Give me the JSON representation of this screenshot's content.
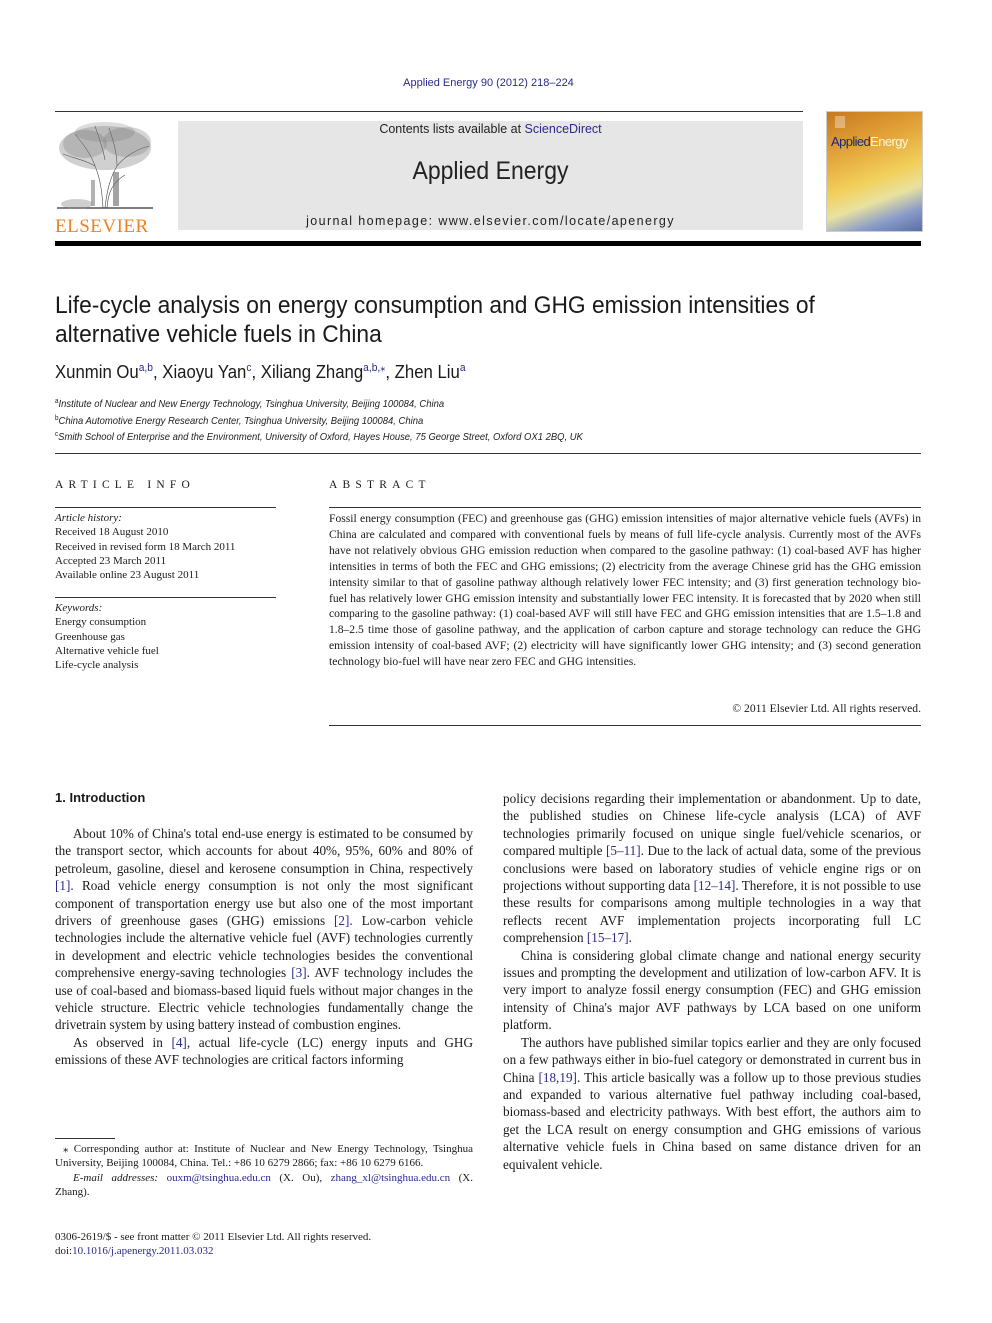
{
  "header": {
    "journal_reference": "Applied Energy 90 (2012) 218–224",
    "contents_prefix": "Contents lists available at ",
    "contents_link": "ScienceDirect",
    "journal_name": "Applied Energy",
    "homepage_label": "journal homepage: www.elsevier.com/locate/apenergy",
    "publisher_logo_text": "ELSEVIER",
    "cover_title_part1": "Applied",
    "cover_title_part2": "Energy",
    "colors": {
      "elsevier_orange": "#f08020",
      "link_blue": "#2a2a8a",
      "header_band_gray": "#e6e6e6"
    }
  },
  "article": {
    "title": "Life-cycle analysis on energy consumption and GHG emission intensities of alternative vehicle fuels in China",
    "authors": [
      {
        "name": "Xunmin Ou",
        "affil": "a,b",
        "sep": ", "
      },
      {
        "name": "Xiaoyu Yan",
        "affil": "c",
        "sep": ", "
      },
      {
        "name": "Xiliang Zhang",
        "affil": "a,b,⁎",
        "sep": ", "
      },
      {
        "name": "Zhen Liu",
        "affil": "a",
        "sep": ""
      }
    ],
    "affiliations": [
      {
        "mark": "a",
        "text": "Institute of Nuclear and New Energy Technology, Tsinghua University, Beijing 100084, China"
      },
      {
        "mark": "b",
        "text": "China Automotive Energy Research Center, Tsinghua University, Beijing 100084, China"
      },
      {
        "mark": "c",
        "text": "Smith School of Enterprise and the Environment, University of Oxford, Hayes House, 75 George Street, Oxford OX1 2BQ, UK"
      }
    ]
  },
  "article_info": {
    "heading": "ARTICLE INFO",
    "history_label": "Article history:",
    "history": [
      "Received 18 August 2010",
      "Received in revised form 18 March 2011",
      "Accepted 23 March 2011",
      "Available online 23 August 2011"
    ],
    "keywords_label": "Keywords:",
    "keywords": [
      "Energy consumption",
      "Greenhouse gas",
      "Alternative vehicle fuel",
      "Life-cycle analysis"
    ]
  },
  "abstract": {
    "heading": "ABSTRACT",
    "text": "Fossil energy consumption (FEC) and greenhouse gas (GHG) emission intensities of major alternative vehicle fuels (AVFs) in China are calculated and compared with conventional fuels by means of full life-cycle analysis. Currently most of the AVFs have not relatively obvious GHG emission reduction when compared to the gasoline pathway: (1) coal-based AVF has higher intensities in terms of both the FEC and GHG emissions; (2) electricity from the average Chinese grid has the GHG emission intensity similar to that of gasoline pathway although relatively lower FEC intensity; and (3) first generation technology bio-fuel has relatively lower GHG emission intensity and substantially lower FEC intensity. It is forecasted that by 2020 when still comparing to the gasoline pathway: (1) coal-based AVF will still have FEC and GHG emission intensities that are 1.5–1.8 and 1.8–2.5 time those of gasoline pathway, and the application of carbon capture and storage technology can reduce the GHG emission intensity of coal-based AVF; (2) electricity will have significantly lower GHG intensity; and (3) second generation technology bio-fuel will have near zero FEC and GHG intensities.",
    "copyright": "© 2011 Elsevier Ltd. All rights reserved."
  },
  "introduction": {
    "heading": "1. Introduction",
    "left_paragraphs": [
      {
        "parts": [
          {
            "t": "About 10% of China's total end-use energy is estimated to be consumed by the transport sector, which accounts for about 40%, 95%, 60% and 80% of petroleum, gasoline, diesel and kerosene consumption in China, respectively "
          },
          {
            "ref": "[1]"
          },
          {
            "t": ". Road vehicle energy consumption is not only the most significant component of transportation energy use but also one of the most important drivers of greenhouse gases (GHG) emissions "
          },
          {
            "ref": "[2]"
          },
          {
            "t": ". Low-carbon vehicle technologies include the alternative vehicle fuel (AVF) technologies currently in development and electric vehicle technologies besides the conventional comprehensive energy-saving technologies "
          },
          {
            "ref": "[3]"
          },
          {
            "t": ". AVF technology includes the use of coal-based and biomass-based liquid fuels without major changes in the vehicle structure. Electric vehicle technologies fundamentally change the drivetrain system by using battery instead of combustion engines."
          }
        ]
      },
      {
        "parts": [
          {
            "t": "As observed in "
          },
          {
            "ref": "[4]"
          },
          {
            "t": ", actual life-cycle (LC) energy inputs and GHG emissions of these AVF technologies are critical factors informing"
          }
        ]
      }
    ],
    "right_paragraphs": [
      {
        "noindent": true,
        "parts": [
          {
            "t": "policy decisions regarding their implementation or abandonment. Up to date, the published studies on Chinese life-cycle analysis (LCA) of AVF technologies primarily focused on unique single fuel/vehicle scenarios, or compared multiple "
          },
          {
            "ref": "[5–11]"
          },
          {
            "t": ". Due to the lack of actual data, some of the previous conclusions were based on laboratory studies of vehicle engine rigs or on projections without supporting data "
          },
          {
            "ref": "[12–14]"
          },
          {
            "t": ". Therefore, it is not possible to use these results for comparisons among multiple technologies in a way that reflects recent AVF implementation projects incorporating full LC comprehension "
          },
          {
            "ref": "[15–17]"
          },
          {
            "t": "."
          }
        ]
      },
      {
        "parts": [
          {
            "t": "China is considering global climate change and national energy security issues and prompting the development and utilization of low-carbon AFV. It is very import to analyze fossil energy consumption (FEC) and GHG emission intensity of China's major AVF pathways by LCA based on one uniform platform."
          }
        ]
      },
      {
        "parts": [
          {
            "t": "The authors have published similar topics earlier and they are only focused on a few pathways either in bio-fuel category or demonstrated in current bus in China "
          },
          {
            "ref": "[18,19]"
          },
          {
            "t": ". This article basically was a follow up to those previous studies and expanded to various alternative fuel pathway including coal-based, biomass-based and electricity pathways. With best effort, the authors aim to get the LCA result on energy consumption and GHG emissions of various alternative vehicle fuels in China based on same distance driven for an equivalent vehicle."
          }
        ]
      }
    ]
  },
  "footnotes": {
    "corresponding": "⁎ Corresponding author at: Institute of Nuclear and New Energy Technology, Tsinghua University, Beijing 100084, China. Tel.: +86 10 6279 2866; fax: +86 10 6279 6166.",
    "email_label": "E-mail addresses:",
    "email1": "ouxm@tsinghua.edu.cn",
    "email1_owner": " (X. Ou), ",
    "email2": "zhang_xl@tsinghua.edu.cn",
    "email2_owner": " (X. Zhang)."
  },
  "front_matter": {
    "issn_line": "0306-2619/$ - see front matter © 2011 Elsevier Ltd. All rights reserved.",
    "doi_prefix": "doi:",
    "doi": "10.1016/j.apenergy.2011.03.032"
  }
}
